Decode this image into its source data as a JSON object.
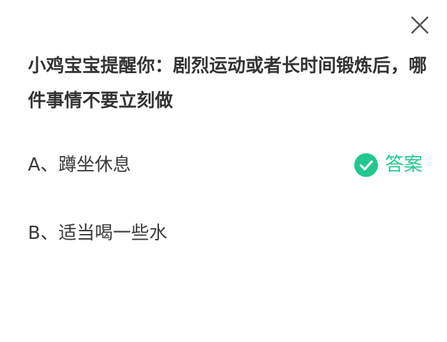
{
  "icons": {
    "close": "close-icon",
    "check": "check-circle-icon"
  },
  "colors": {
    "accent": "#23c78b",
    "text": "#333333",
    "close_icon": "#555555"
  },
  "question": {
    "text": "小鸡宝宝提醒你：剧烈运动或者长时间锻炼后，哪件事情不要立刻做"
  },
  "options": [
    {
      "label": "A、蹲坐休息"
    },
    {
      "label": "B、适当喝一些水"
    }
  ],
  "answer": {
    "label": "答案"
  }
}
